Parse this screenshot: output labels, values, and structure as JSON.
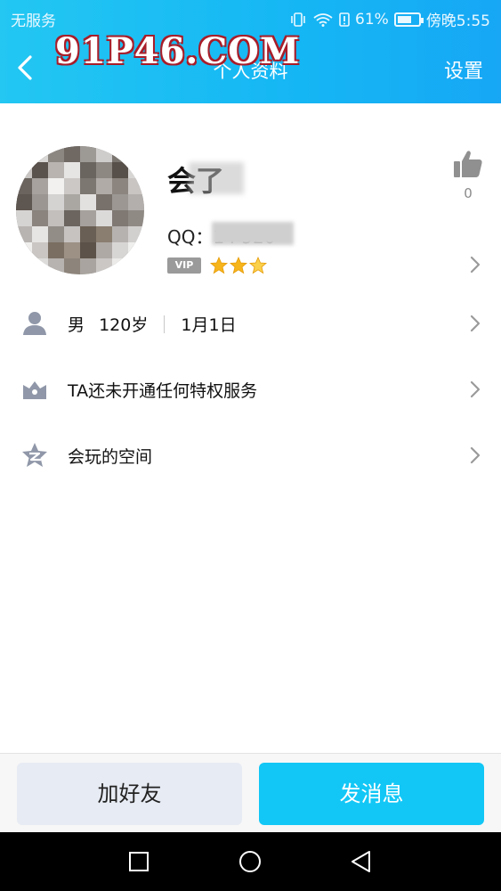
{
  "status_bar": {
    "carrier": "无服务",
    "battery": "61%",
    "time": "傍晚5:55"
  },
  "header": {
    "title": "个人资料",
    "settings_label": "设置",
    "watermark": "91P46.COM"
  },
  "profile": {
    "name": "会了",
    "qq": "QQ：14      520",
    "vip_badge": "VIP",
    "level_stars": 3,
    "like_count": "0"
  },
  "rows": [
    {
      "icon": "person-icon",
      "gender": "男",
      "age": "120岁",
      "birthday": "1月1日"
    },
    {
      "icon": "privilege-icon",
      "label": "TA还未开通任何特权服务"
    },
    {
      "icon": "qzone-star-icon",
      "label": "会玩的空间"
    }
  ],
  "actions": {
    "add_friend": "加好友",
    "send_message": "发消息"
  },
  "colors": {
    "header_gradient_start": "#23c7f2",
    "header_gradient_end": "#17a7f5",
    "primary_button": "#12c7f6",
    "secondary_button": "#e7ebf3"
  }
}
